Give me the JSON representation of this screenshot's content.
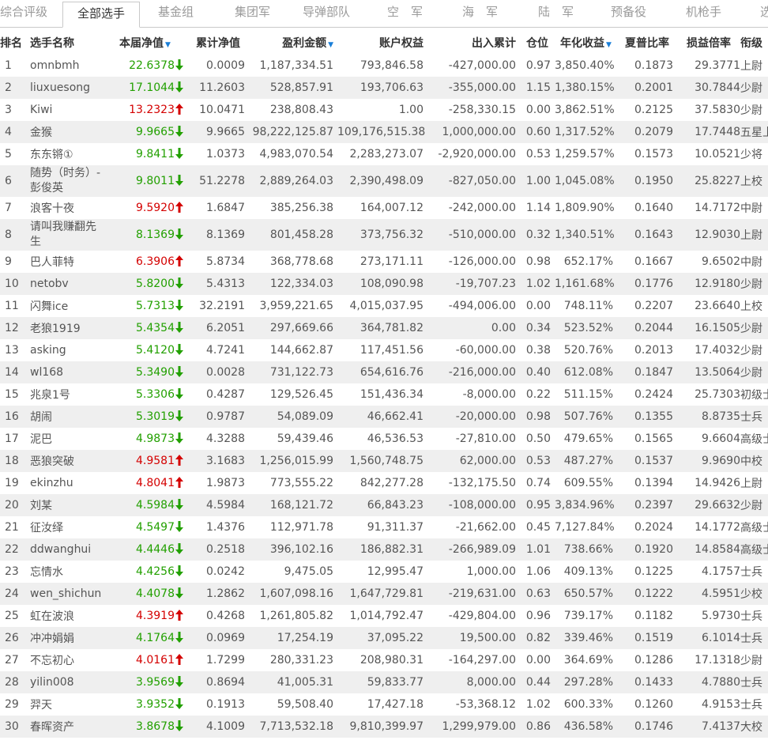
{
  "tabs": [
    "综合评级",
    "全部选手",
    "基金组",
    "集团军",
    "导弹部队",
    "空　军",
    "海　军",
    "陆　军",
    "预备役",
    "机枪手",
    "选"
  ],
  "active_tab": 1,
  "columns": {
    "rank": "排名",
    "name": "选手名称",
    "nav": "本届净值",
    "cum_nav": "累计净值",
    "profit": "盈利金额",
    "equity": "账户权益",
    "flow": "出入累计",
    "position": "仓位",
    "annual": "年化收益",
    "sharpe": "夏普比率",
    "ratio": "损益倍率",
    "rank_title": "衔级"
  },
  "colors": {
    "up": "#d40000",
    "down": "#22a000",
    "sort_icon": "#1a7fd8",
    "row_alt": "#efefef"
  },
  "rows": [
    {
      "rank": "1",
      "name": "omnbmh",
      "nav": "22.6378",
      "dir": "down",
      "cum_nav": "0.0009",
      "profit": "1,187,334.51",
      "equity": "793,846.58",
      "flow": "-427,000.00",
      "position": "0.97",
      "annual": "3,850.40%",
      "sharpe": "0.1873",
      "ratio": "29.3771",
      "title": "上尉"
    },
    {
      "rank": "2",
      "name": "liuxuesong",
      "nav": "17.1044",
      "dir": "down",
      "cum_nav": "11.2603",
      "profit": "528,857.91",
      "equity": "193,706.63",
      "flow": "-355,000.00",
      "position": "1.15",
      "annual": "1,380.15%",
      "sharpe": "0.2001",
      "ratio": "30.7844",
      "title": "少尉"
    },
    {
      "rank": "3",
      "name": "Kiwi",
      "nav": "13.2323",
      "dir": "up",
      "cum_nav": "10.0471",
      "profit": "238,808.43",
      "equity": "1.00",
      "flow": "-258,330.15",
      "position": "0.00",
      "annual": "3,862.51%",
      "sharpe": "0.2125",
      "ratio": "37.5830",
      "title": "少尉"
    },
    {
      "rank": "4",
      "name": "金猴",
      "nav": "9.9665",
      "dir": "down",
      "cum_nav": "9.9665",
      "profit": "98,222,125.87",
      "equity": "109,176,515.38",
      "flow": "1,000,000.00",
      "position": "0.60",
      "annual": "1,317.52%",
      "sharpe": "0.2079",
      "ratio": "17.7448",
      "title": "五星上将"
    },
    {
      "rank": "5",
      "name": "东东锵①",
      "nav": "9.8411",
      "dir": "down",
      "cum_nav": "1.0373",
      "profit": "4,983,070.54",
      "equity": "2,283,273.07",
      "flow": "-2,920,000.00",
      "position": "0.53",
      "annual": "1,259.57%",
      "sharpe": "0.1573",
      "ratio": "10.0521",
      "title": "少将"
    },
    {
      "rank": "6",
      "name": "随势（时务）-彭俊英",
      "nav": "9.8011",
      "dir": "down",
      "cum_nav": "51.2278",
      "profit": "2,889,264.03",
      "equity": "2,390,498.09",
      "flow": "-827,050.00",
      "position": "1.00",
      "annual": "1,045.08%",
      "sharpe": "0.1950",
      "ratio": "25.8227",
      "title": "上校",
      "tall": true
    },
    {
      "rank": "7",
      "name": "浪客十夜",
      "nav": "9.5920",
      "dir": "up",
      "cum_nav": "1.6847",
      "profit": "385,256.38",
      "equity": "164,007.12",
      "flow": "-242,000.00",
      "position": "1.14",
      "annual": "1,809.90%",
      "sharpe": "0.1640",
      "ratio": "14.7172",
      "title": "中尉"
    },
    {
      "rank": "8",
      "name": "请叫我赚翻先生",
      "nav": "8.1369",
      "dir": "down",
      "cum_nav": "8.1369",
      "profit": "801,458.28",
      "equity": "373,756.32",
      "flow": "-510,000.00",
      "position": "0.32",
      "annual": "1,340.51%",
      "sharpe": "0.1643",
      "ratio": "12.9030",
      "title": "上尉",
      "tall": true
    },
    {
      "rank": "9",
      "name": "巴人菲特",
      "nav": "6.3906",
      "dir": "up",
      "cum_nav": "5.8734",
      "profit": "368,778.68",
      "equity": "273,171.11",
      "flow": "-126,000.00",
      "position": "0.98",
      "annual": "652.17%",
      "sharpe": "0.1667",
      "ratio": "9.6502",
      "title": "中尉"
    },
    {
      "rank": "10",
      "name": "netobv",
      "nav": "5.8200",
      "dir": "down",
      "cum_nav": "5.4313",
      "profit": "122,334.03",
      "equity": "108,090.98",
      "flow": "-19,707.23",
      "position": "1.02",
      "annual": "1,161.68%",
      "sharpe": "0.1776",
      "ratio": "12.9180",
      "title": "少尉"
    },
    {
      "rank": "11",
      "name": "闪舞ice",
      "nav": "5.7313",
      "dir": "down",
      "cum_nav": "32.2191",
      "profit": "3,959,221.65",
      "equity": "4,015,037.95",
      "flow": "-494,006.00",
      "position": "0.00",
      "annual": "748.11%",
      "sharpe": "0.2207",
      "ratio": "23.6640",
      "title": "上校"
    },
    {
      "rank": "12",
      "name": "老狼1919",
      "nav": "5.4354",
      "dir": "down",
      "cum_nav": "6.2051",
      "profit": "297,669.66",
      "equity": "364,781.82",
      "flow": "0.00",
      "position": "0.34",
      "annual": "523.52%",
      "sharpe": "0.2044",
      "ratio": "16.1505",
      "title": "少尉"
    },
    {
      "rank": "13",
      "name": "asking",
      "nav": "5.4120",
      "dir": "down",
      "cum_nav": "4.7241",
      "profit": "144,662.87",
      "equity": "117,451.56",
      "flow": "-60,000.00",
      "position": "0.38",
      "annual": "520.76%",
      "sharpe": "0.2013",
      "ratio": "17.4032",
      "title": "少尉"
    },
    {
      "rank": "14",
      "name": "wl168",
      "nav": "5.3490",
      "dir": "down",
      "cum_nav": "0.0028",
      "profit": "731,122.73",
      "equity": "654,616.76",
      "flow": "-216,000.00",
      "position": "0.40",
      "annual": "612.08%",
      "sharpe": "0.1847",
      "ratio": "13.5064",
      "title": "少尉"
    },
    {
      "rank": "15",
      "name": "兆泉1号",
      "nav": "5.3306",
      "dir": "down",
      "cum_nav": "0.4287",
      "profit": "129,526.45",
      "equity": "151,436.34",
      "flow": "-8,000.00",
      "position": "0.22",
      "annual": "511.15%",
      "sharpe": "0.2424",
      "ratio": "25.7303",
      "title": "初级士官"
    },
    {
      "rank": "16",
      "name": "胡闹",
      "nav": "5.3019",
      "dir": "down",
      "cum_nav": "0.9787",
      "profit": "54,089.09",
      "equity": "46,662.41",
      "flow": "-20,000.00",
      "position": "0.98",
      "annual": "507.76%",
      "sharpe": "0.1355",
      "ratio": "8.8735",
      "title": "士兵"
    },
    {
      "rank": "17",
      "name": "泥巴",
      "nav": "4.9873",
      "dir": "down",
      "cum_nav": "4.3288",
      "profit": "59,439.46",
      "equity": "46,536.53",
      "flow": "-27,810.00",
      "position": "0.50",
      "annual": "479.65%",
      "sharpe": "0.1565",
      "ratio": "9.6604",
      "title": "高级士官"
    },
    {
      "rank": "18",
      "name": "恶狼突破",
      "nav": "4.9581",
      "dir": "up",
      "cum_nav": "3.1683",
      "profit": "1,256,015.99",
      "equity": "1,560,748.75",
      "flow": "62,000.00",
      "position": "0.53",
      "annual": "487.27%",
      "sharpe": "0.1537",
      "ratio": "9.9690",
      "title": "中校"
    },
    {
      "rank": "19",
      "name": "ekinzhu",
      "nav": "4.8041",
      "dir": "up",
      "cum_nav": "1.9873",
      "profit": "773,555.22",
      "equity": "842,277.28",
      "flow": "-132,175.50",
      "position": "0.74",
      "annual": "609.55%",
      "sharpe": "0.1394",
      "ratio": "14.9426",
      "title": "上尉"
    },
    {
      "rank": "20",
      "name": "刘某",
      "nav": "4.5984",
      "dir": "down",
      "cum_nav": "4.5984",
      "profit": "168,121.72",
      "equity": "66,843.23",
      "flow": "-108,000.00",
      "position": "0.95",
      "annual": "3,834.96%",
      "sharpe": "0.2397",
      "ratio": "29.6632",
      "title": "少尉"
    },
    {
      "rank": "21",
      "name": "征汝绎",
      "nav": "4.5497",
      "dir": "down",
      "cum_nav": "1.4376",
      "profit": "112,971.78",
      "equity": "91,311.37",
      "flow": "-21,662.00",
      "position": "0.45",
      "annual": "7,127.84%",
      "sharpe": "0.2024",
      "ratio": "14.1772",
      "title": "高级士官"
    },
    {
      "rank": "22",
      "name": "ddwanghui",
      "nav": "4.4446",
      "dir": "down",
      "cum_nav": "0.2518",
      "profit": "396,102.16",
      "equity": "186,882.31",
      "flow": "-266,989.09",
      "position": "1.01",
      "annual": "738.66%",
      "sharpe": "0.1920",
      "ratio": "14.8584",
      "title": "高级士官"
    },
    {
      "rank": "23",
      "name": "忘情水",
      "nav": "4.4256",
      "dir": "down",
      "cum_nav": "0.0242",
      "profit": "9,475.05",
      "equity": "12,995.47",
      "flow": "1,000.00",
      "position": "1.06",
      "annual": "409.13%",
      "sharpe": "0.1225",
      "ratio": "4.1757",
      "title": "士兵"
    },
    {
      "rank": "24",
      "name": "wen_shichun",
      "nav": "4.4078",
      "dir": "down",
      "cum_nav": "1.2862",
      "profit": "1,607,098.16",
      "equity": "1,647,729.81",
      "flow": "-219,631.00",
      "position": "0.63",
      "annual": "650.57%",
      "sharpe": "0.1222",
      "ratio": "4.5951",
      "title": "少校"
    },
    {
      "rank": "25",
      "name": "虹在波浪",
      "nav": "4.3919",
      "dir": "up",
      "cum_nav": "0.4268",
      "profit": "1,261,805.82",
      "equity": "1,014,792.47",
      "flow": "-429,804.00",
      "position": "0.96",
      "annual": "739.17%",
      "sharpe": "0.1182",
      "ratio": "5.9730",
      "title": "士兵"
    },
    {
      "rank": "26",
      "name": "冲冲娟娟",
      "nav": "4.1764",
      "dir": "down",
      "cum_nav": "0.0969",
      "profit": "17,254.19",
      "equity": "37,095.22",
      "flow": "19,500.00",
      "position": "0.82",
      "annual": "339.46%",
      "sharpe": "0.1519",
      "ratio": "6.1014",
      "title": "士兵"
    },
    {
      "rank": "27",
      "name": "不忘初心",
      "nav": "4.0161",
      "dir": "up",
      "cum_nav": "1.7299",
      "profit": "280,331.23",
      "equity": "208,980.31",
      "flow": "-164,297.00",
      "position": "0.00",
      "annual": "364.69%",
      "sharpe": "0.1286",
      "ratio": "17.1318",
      "title": "少尉"
    },
    {
      "rank": "28",
      "name": "yilin008",
      "nav": "3.9569",
      "dir": "down",
      "cum_nav": "0.8694",
      "profit": "41,005.31",
      "equity": "59,833.77",
      "flow": "8,000.00",
      "position": "0.44",
      "annual": "297.28%",
      "sharpe": "0.1433",
      "ratio": "4.7880",
      "title": "士兵"
    },
    {
      "rank": "29",
      "name": "羿天",
      "nav": "3.9352",
      "dir": "down",
      "cum_nav": "0.1913",
      "profit": "59,508.40",
      "equity": "17,427.18",
      "flow": "-53,368.12",
      "position": "1.02",
      "annual": "600.33%",
      "sharpe": "0.1260",
      "ratio": "4.9153",
      "title": "士兵"
    },
    {
      "rank": "30",
      "name": "春晖资产",
      "nav": "3.8678",
      "dir": "down",
      "cum_nav": "4.1009",
      "profit": "7,713,532.18",
      "equity": "9,810,399.97",
      "flow": "1,299,979.00",
      "position": "0.86",
      "annual": "436.58%",
      "sharpe": "0.1746",
      "ratio": "7.4137",
      "title": "大校"
    }
  ]
}
